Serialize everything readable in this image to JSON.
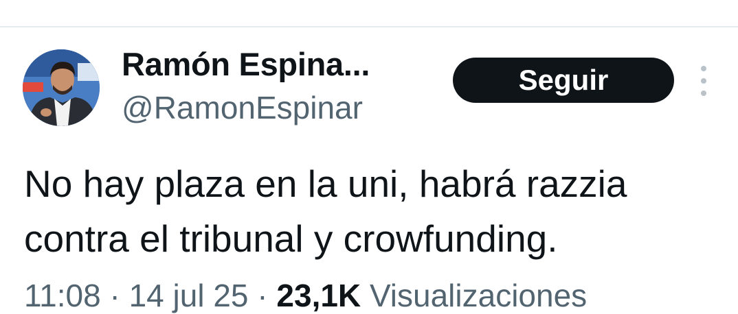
{
  "tweet": {
    "author": {
      "display_name": "Ramón Espina...",
      "handle": "@RamonEspinar",
      "avatar": "avatar-photo"
    },
    "follow_label": "Seguir",
    "more_icon": "more-vertical-icon",
    "text_line_1": "No hay plaza en la uni, habrá razzia",
    "text_line_2": "contra el tribunal y crowfunding.",
    "meta": {
      "time": "11:08",
      "date": "14 jul 25",
      "views_count": "23,1K",
      "views_label": "Visualizaciones"
    }
  },
  "colors": {
    "primary_text": "#0f1419",
    "secondary_text": "#536471",
    "button_bg": "#0f1419",
    "divider": "#e4ecee"
  }
}
